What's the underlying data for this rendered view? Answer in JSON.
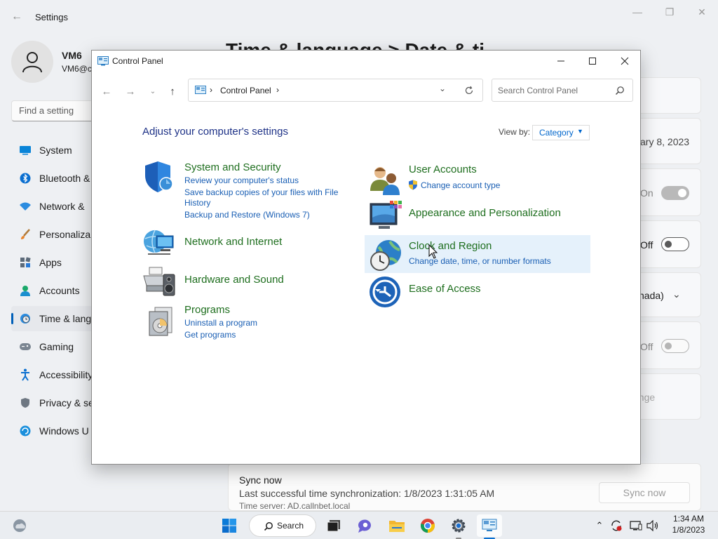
{
  "settings": {
    "title": "Settings",
    "user_name": "VM6",
    "user_email": "VM6@c",
    "search_placeholder": "Find a setting",
    "page_title": "Time & language  >  Date & ti",
    "nav": [
      {
        "label": "System",
        "icon": "monitor-icon"
      },
      {
        "label": "Bluetooth &",
        "icon": "bluetooth-icon"
      },
      {
        "label": "Network &",
        "icon": "wifi-icon"
      },
      {
        "label": "Personaliza",
        "icon": "brush-icon"
      },
      {
        "label": "Apps",
        "icon": "apps-icon"
      },
      {
        "label": "Accounts",
        "icon": "person-icon"
      },
      {
        "label": "Time & lang",
        "icon": "clock-globe-icon",
        "active": true
      },
      {
        "label": "Gaming",
        "icon": "gamepad-icon"
      },
      {
        "label": "Accessibility",
        "icon": "accessibility-icon"
      },
      {
        "label": "Privacy & se",
        "icon": "shield-icon"
      },
      {
        "label": "Windows U",
        "icon": "update-icon"
      }
    ],
    "date_fragment": "ary 8, 2023",
    "toggle1_text": "On",
    "toggle2_text": "Off",
    "dropdown_fragment": "nada)",
    "toggle3_text": "Off",
    "change_fragment": "ange",
    "sync_title": "Sync now",
    "sync_last": "Last successful time synchronization: 1/8/2023 1:31:05 AM",
    "sync_server": "Time server: AD.callnbet.local",
    "sync_button": "Sync now"
  },
  "control_panel": {
    "window_title": "Control Panel",
    "breadcrumb": "Control Panel",
    "search_placeholder": "Search Control Panel",
    "heading": "Adjust your computer's settings",
    "view_by_label": "View by:",
    "view_by_value": "Category",
    "categories": [
      {
        "title": "System and Security",
        "icon": "shield-icon",
        "links": [
          "Review your computer's status",
          "Save backup copies of your files with File",
          "History",
          "Backup and Restore (Windows 7)"
        ]
      },
      {
        "title": "Network and Internet",
        "icon": "network-globe-icon",
        "links": []
      },
      {
        "title": "Hardware and Sound",
        "icon": "printer-speaker-icon",
        "links": []
      },
      {
        "title": "Programs",
        "icon": "programs-disc-icon",
        "links": [
          "Uninstall a program",
          "Get programs"
        ]
      },
      {
        "title": "User Accounts",
        "icon": "users-icon",
        "links": [
          "Change account type"
        ]
      },
      {
        "title": "Appearance and Personalization",
        "icon": "display-colors-icon",
        "links": []
      },
      {
        "title": "Clock and Region",
        "icon": "clock-globe-icon",
        "links": [
          "Change date, time, or number formats"
        ]
      },
      {
        "title": "Ease of Access",
        "icon": "ease-of-access-icon",
        "links": []
      }
    ]
  },
  "taskbar": {
    "search_label": "Search",
    "time": "1:34 AM",
    "date": "1/8/2023"
  }
}
